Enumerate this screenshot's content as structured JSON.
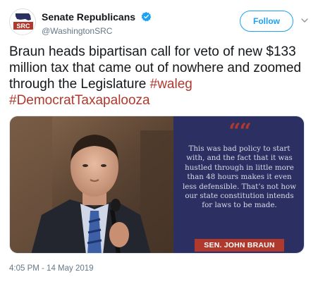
{
  "account": {
    "display_name": "Senate Republicans",
    "handle": "@WashingtonSRC",
    "avatar_label": "SRC",
    "verified": true
  },
  "actions": {
    "follow_label": "Follow"
  },
  "icons": {
    "verified": "verified-badge-icon",
    "menu": "chevron-down-icon"
  },
  "tweet": {
    "text_main": "Braun heads bipartisan call for veto of new $133 million tax that came out of nowhere and zoomed through the Legislature ",
    "hashtag_1": "#waleg",
    "hashtag_2": "#DemocratTaxapalooza"
  },
  "media": {
    "quote_mark": "““",
    "quote": "This was bad policy to start with, and the fact that it was hustled through in little more than 48 hours makes it even less defensible. That’s not how our state constitution intends for laws to be made.",
    "attribution": "SEN. JOHN BRAUN"
  },
  "timestamp": "4:05 PM - 14 May 2019",
  "colors": {
    "accent": "#1da1f2",
    "hashtag": "#b0392e",
    "panel": "#2c2f62"
  }
}
